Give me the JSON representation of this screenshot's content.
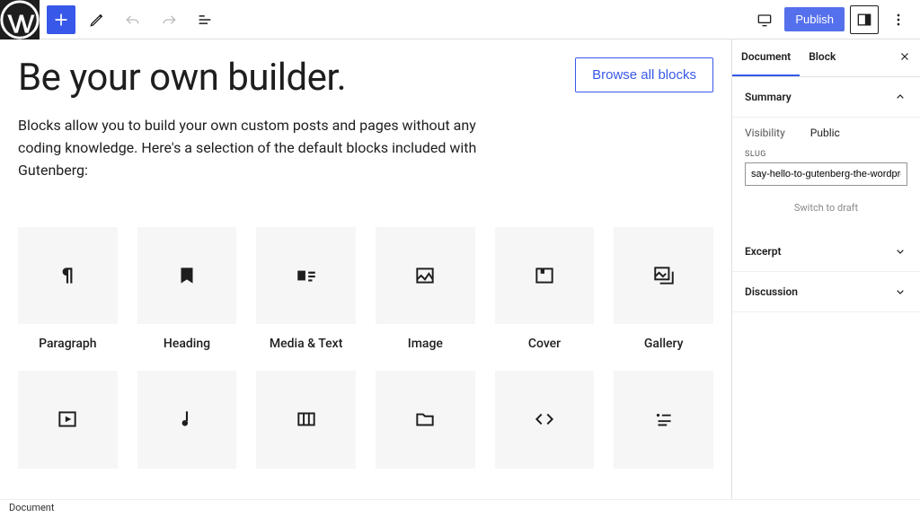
{
  "toolbar": {
    "publish_label": "Publish"
  },
  "editor": {
    "title": "Be your own builder.",
    "browse_label": "Browse all blocks",
    "intro": "Blocks allow you to build your own custom posts and pages without any coding knowledge. Here's a selection of the default blocks included with Gutenberg:",
    "blocks": [
      {
        "label": "Paragraph"
      },
      {
        "label": "Heading"
      },
      {
        "label": "Media & Text"
      },
      {
        "label": "Image"
      },
      {
        "label": "Cover"
      },
      {
        "label": "Gallery"
      },
      {
        "label": ""
      },
      {
        "label": ""
      },
      {
        "label": ""
      },
      {
        "label": ""
      },
      {
        "label": ""
      },
      {
        "label": ""
      }
    ]
  },
  "sidebar": {
    "tabs": {
      "document": "Document",
      "block": "Block"
    },
    "summary": {
      "title": "Summary",
      "visibility_label": "Visibility",
      "visibility_value": "Public",
      "slug_label": "SLUG",
      "slug_value": "say-hello-to-gutenberg-the-wordpress-ed",
      "switch_draft": "Switch to draft"
    },
    "excerpt_title": "Excerpt",
    "discussion_title": "Discussion"
  },
  "footer": {
    "breadcrumb": "Document"
  }
}
